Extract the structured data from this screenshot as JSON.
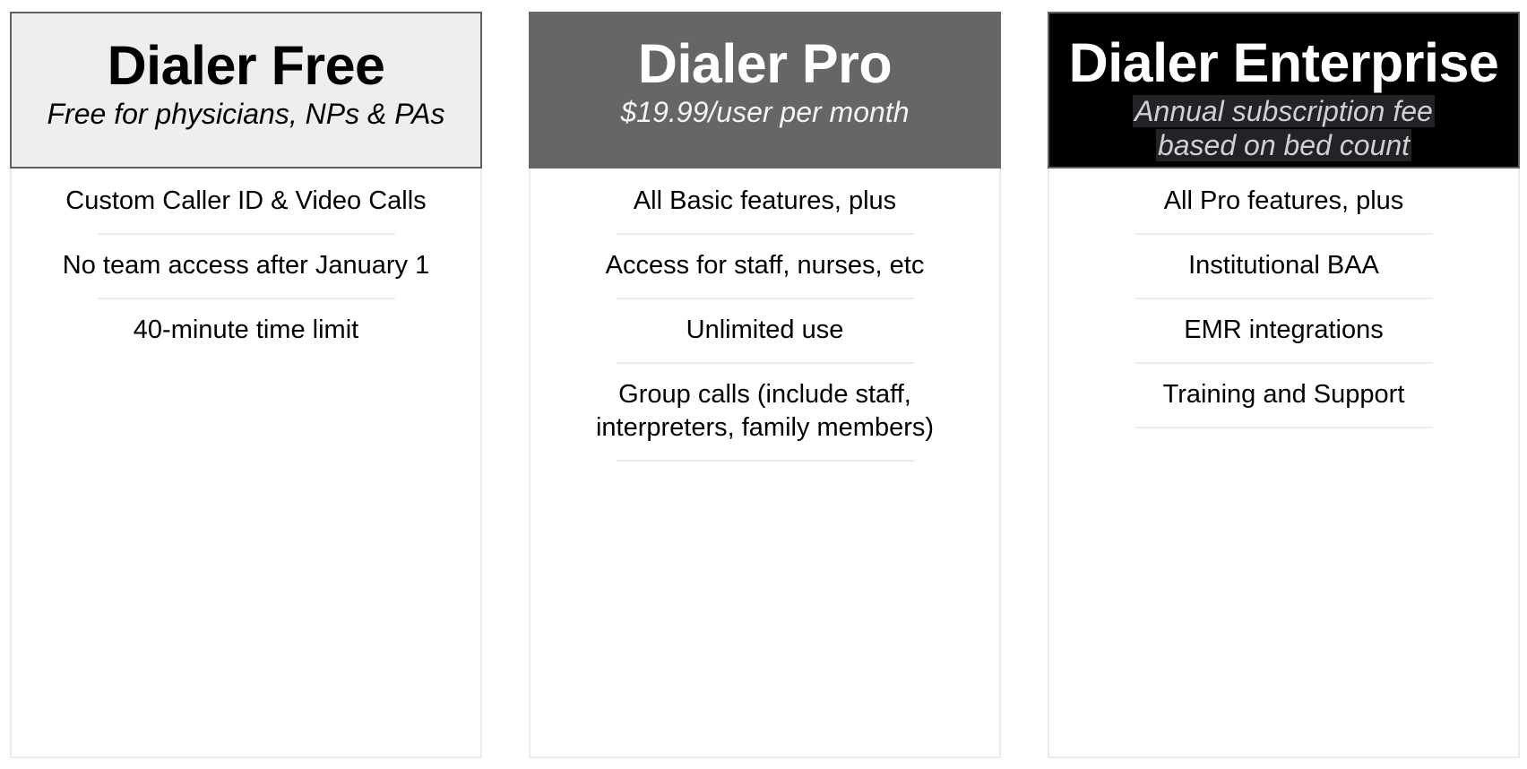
{
  "plans": [
    {
      "name": "Dialer Free",
      "subtitle": "Free for physicians, NPs & PAs",
      "features": [
        "Custom Caller ID & Video Calls",
        "No team access after January 1",
        "40-minute time limit"
      ]
    },
    {
      "name": "Dialer Pro",
      "subtitle": "$19.99/user per month",
      "features": [
        "All Basic features, plus",
        "Access for staff, nurses, etc",
        "Unlimited use",
        "Group calls (include staff, interpreters, family members)"
      ]
    },
    {
      "name": "Dialer Enterprise",
      "subtitle_lines": [
        "Annual subscription fee",
        "based on bed count"
      ],
      "features": [
        "All Pro features, plus",
        "Institutional BAA",
        "EMR integrations",
        "Training and Support"
      ]
    }
  ],
  "colors": {
    "free_header_bg": "#eeeeee",
    "pro_header_bg": "#666666",
    "enterprise_header_bg": "#000000",
    "divider": "#ebebeb"
  }
}
